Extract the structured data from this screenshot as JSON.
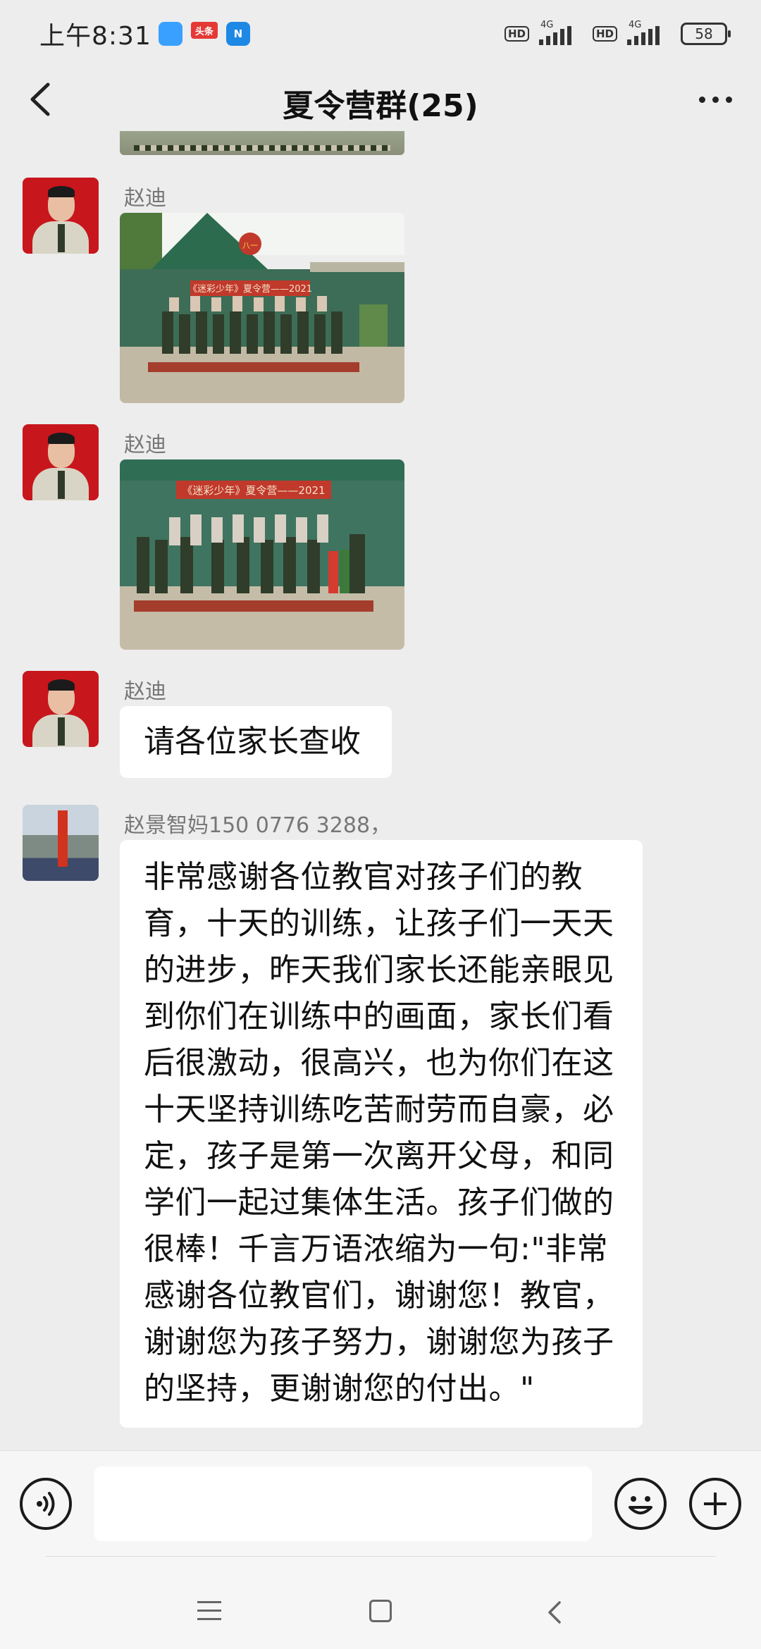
{
  "status_bar": {
    "time": "上午8:31",
    "apps": [
      "头条",
      "N"
    ],
    "hd": "HD",
    "network": "4G",
    "battery": "58"
  },
  "header": {
    "title": "夏令营群(25)",
    "back_icon": "back-arrow-icon",
    "more_icon": "more-dots-icon"
  },
  "messages": [
    {
      "type": "image",
      "sender": "赵迪",
      "banner_text": "《迷彩少年》夏令营——2021",
      "badge": "八一"
    },
    {
      "type": "image",
      "sender": "赵迪",
      "banner_text": "《迷彩少年》夏令营——2021"
    },
    {
      "type": "text",
      "sender": "赵迪",
      "text": "请各位家长查收"
    },
    {
      "type": "text",
      "sender": "赵景智妈150 0776 3288，",
      "lines": [
        "非常感谢各位教官对孩子们的教",
        "育，十天的训练，让孩子们一天天",
        "的进步，昨天我们家长还能亲眼见",
        "到你们在训练中的画面，家长们看",
        "后很激动，很高兴，也为你们在这",
        "十天坚持训练吃苦耐劳而自豪，必",
        "定，孩子是第一次离开父母，和同",
        "学们一起过集体生活。孩子们做的",
        "很棒！千言万语浓缩为一句:\"非常",
        "感谢各位教官们，谢谢您！教官，",
        "谢谢您为孩子努力，谢谢您为孩子",
        "的坚持，更谢谢您的付出。\""
      ]
    }
  ],
  "input_bar": {
    "voice_icon": "voice-icon",
    "emoji_icon": "emoji-icon",
    "plus_icon": "plus-icon",
    "placeholder": ""
  },
  "nav_bar": {
    "menu_icon": "menu-icon",
    "home_icon": "home-icon",
    "back_icon": "nav-back-icon"
  },
  "colors": {
    "background": "#ededed",
    "bubble": "#ffffff",
    "avatar_red": "#c8161d"
  }
}
